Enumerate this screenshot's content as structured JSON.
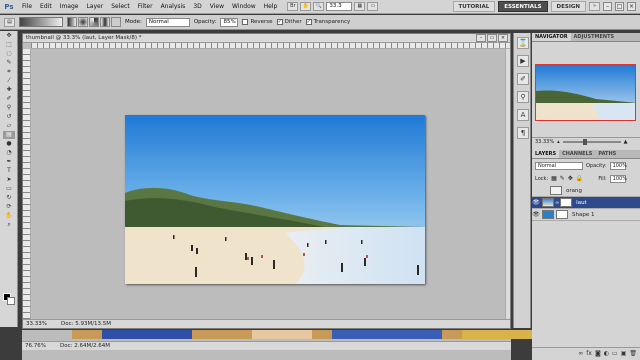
{
  "menubar": {
    "logo": "Ps",
    "items": [
      "File",
      "Edit",
      "Image",
      "Layer",
      "Select",
      "Filter",
      "Analysis",
      "3D",
      "View",
      "Window",
      "Help"
    ],
    "zoom_value": "33.3",
    "workspaces": [
      "TUTORIAL",
      "ESSENTIALS",
      "DESIGN"
    ],
    "active_workspace": "ESSENTIALS"
  },
  "options": {
    "mode_label": "Mode:",
    "mode_value": "Normal",
    "opacity_label": "Opacity:",
    "opacity_value": "85%",
    "reverse_label": "Reverse",
    "dither_label": "Dither",
    "transparency_label": "Transparency",
    "reverse_checked": false,
    "dither_checked": true,
    "transparency_checked": true
  },
  "document": {
    "title": "thumbnail @ 33.3% (laut, Layer Mask/8) *",
    "zoom": "33.33%",
    "doc_size": "Doc: 5.93M/13.5M"
  },
  "document2": {
    "zoom": "76.76%",
    "doc_size": "Doc: 2.64M/2.64M"
  },
  "navigator": {
    "tabs": [
      "NAVIGATOR",
      "ADJUSTMENTS"
    ],
    "zoom": "33.33%"
  },
  "layers_panel": {
    "tabs": [
      "LAYERS",
      "CHANNELS",
      "PATHS"
    ],
    "blend_mode": "Normal",
    "opacity_label": "Opacity:",
    "opacity_value": "100%",
    "lock_label": "Lock:",
    "fill_label": "Fill:",
    "fill_value": "100%",
    "layers": [
      {
        "name": "orang",
        "visible": false,
        "selected": false
      },
      {
        "name": "laut",
        "visible": true,
        "selected": true
      },
      {
        "name": "Shape 1",
        "visible": true,
        "selected": false
      }
    ]
  },
  "colors": {
    "selected_layer": "#2f4a8c",
    "sky_top": "#1f7ad6",
    "sky_bottom": "#d5e8f4",
    "sand": "#efe3cc",
    "forest": "#4f6a3a"
  }
}
